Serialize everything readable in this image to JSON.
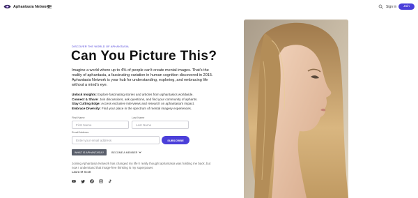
{
  "nav": {
    "brand": "Aphantasia Network",
    "signin": "Sign in",
    "join": "Join"
  },
  "hero": {
    "eyebrow": "DISCOVER THE WORLD OF APHANTASIA",
    "title": "Can You Picture This?",
    "intro": "Imagine a world where up to 4% of people can't create mental images. That's the reality of aphantasia, a fascinating variation in human cognition discovered in 2015. Aphantasia Network is your hub for understanding, exploring, and embracing life without a mind's eye.",
    "features": [
      {
        "title": "Unlock Insights:",
        "text": "Explore fascinating stories and articles from aphantasics worldwide."
      },
      {
        "title": "Connect & Share:",
        "text": "Join discussions, ask questions, and find your community of aphants."
      },
      {
        "title": "Stay Cutting Edge:",
        "text": "Access exclusive interviews and research on aphantasia's impact."
      },
      {
        "title": "Embrace Diversity:",
        "text": "Find your place in the spectrum of mental imagery experiences."
      }
    ]
  },
  "form": {
    "first_label": "First Name",
    "first_placeholder": "First Name",
    "last_label": "Last Name",
    "last_placeholder": "Last Name",
    "email_label": "Email Address",
    "email_placeholder": "Enter your email address",
    "subscribe": "SUBSCRIBE"
  },
  "ctas": {
    "what": "WHAT IS APHANTASIA?",
    "member": "BECOME A MEMBER"
  },
  "testimonial": {
    "quote": "Joining Aphantasia Network has changed my life! I really thought aphantasia was holding me back, but now I understand that image-free thinking is my superpower.",
    "author": "Laura M Scott"
  },
  "socials": [
    "youtube-icon",
    "twitter-icon",
    "facebook-icon",
    "instagram-icon",
    "tiktok-icon"
  ],
  "colors": {
    "accent": "#4b3fd9",
    "dark_button": "#5a5f6b"
  }
}
